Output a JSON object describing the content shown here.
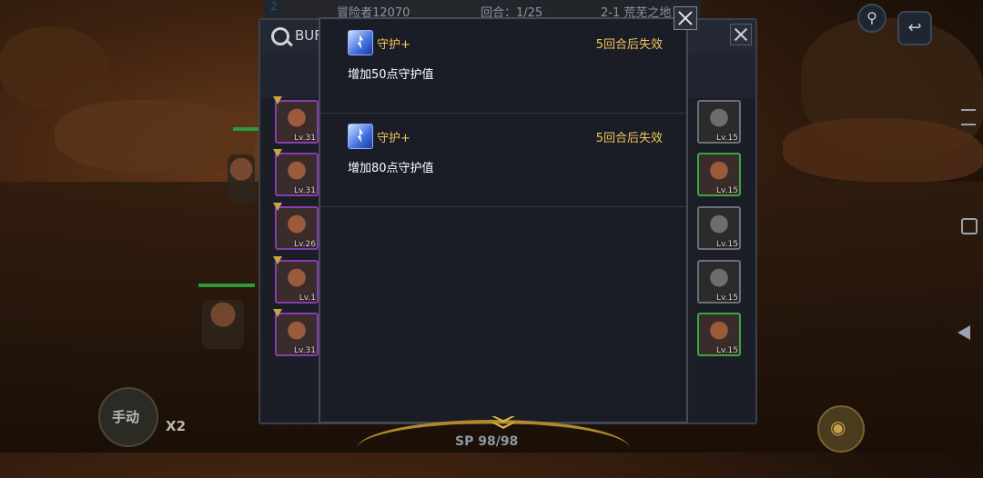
{
  "hud": {
    "wave_badge": "2",
    "player_name": "冒险者12070",
    "round": "回合：1/25",
    "stage": "2-1 荒芜之地"
  },
  "controls": {
    "manual": "手动",
    "speed": "X2",
    "sp": "SP 98/98"
  },
  "back_panel": {
    "title": "BUF",
    "left_team": [
      {
        "level": "Lv.31",
        "rank": true
      },
      {
        "level": "Lv.31",
        "rank": true
      },
      {
        "level": "Lv.26",
        "rank": true
      },
      {
        "level": "Lv.1",
        "rank": true
      },
      {
        "level": "Lv.31",
        "rank": true
      }
    ],
    "right_team": [
      {
        "level": "Lv.15"
      },
      {
        "level": "Lv.15"
      },
      {
        "level": "Lv.15"
      },
      {
        "level": "Lv.15"
      },
      {
        "level": "Lv.15"
      }
    ]
  },
  "popup": {
    "buffs": [
      {
        "icon": "shield-buff-icon",
        "name": "守护+",
        "duration": "5回合后失效",
        "description": "增加50点守护值"
      },
      {
        "icon": "shield-buff-icon",
        "name": "守护+",
        "duration": "5回合后失效",
        "description": "增加80点守护值"
      }
    ]
  },
  "colors": {
    "accent_gold": "#f1c65a",
    "popup_bg": "#1a1c26",
    "border_purple": "#8a3bb0",
    "border_green": "#3ca63f"
  }
}
